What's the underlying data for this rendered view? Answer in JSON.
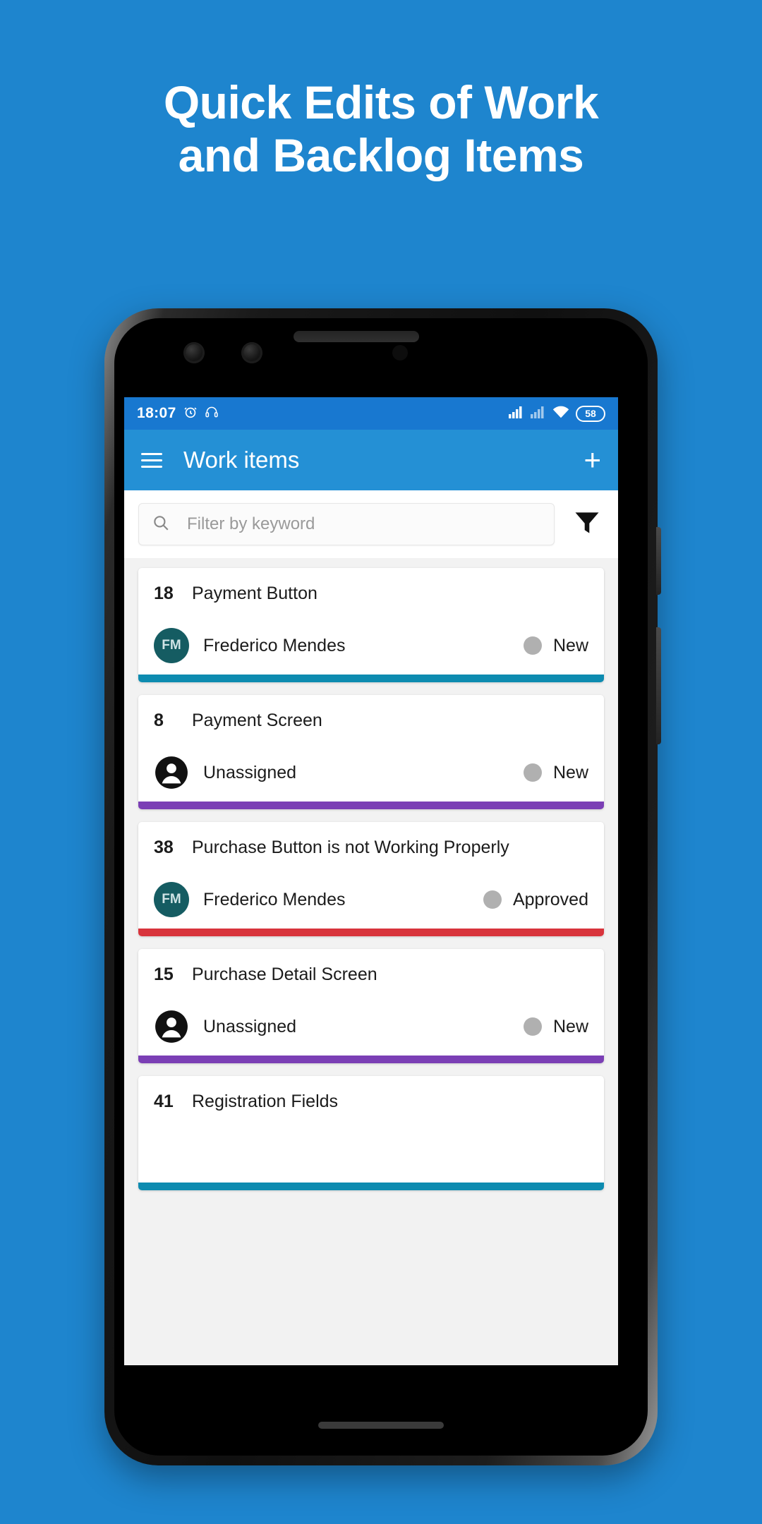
{
  "promo": {
    "background_color": "#1E85CE",
    "headline_line1": "Quick Edits of Work",
    "headline_line2": "and Backlog Items"
  },
  "status_bar": {
    "time": "18:07",
    "alarm_icon": "alarm-icon",
    "headset_icon": "headset-icon",
    "signal_icon_1": "signal-bars-icon",
    "signal_icon_2": "signal-bars-icon",
    "wifi_icon": "wifi-icon",
    "battery_level": "58",
    "background_color": "#1878D0"
  },
  "app_bar": {
    "menu_icon": "list-menu-icon",
    "title": "Work items",
    "add_label": "+",
    "background_color": "#2490D5"
  },
  "filter_bar": {
    "search_icon": "search-icon",
    "search_value": "",
    "search_placeholder": "Filter by keyword",
    "filter_icon": "funnel-filter-icon"
  },
  "work_items": [
    {
      "id": "18",
      "title": "Payment Button",
      "assignee": "Frederico Mendes",
      "assignee_initials": "FM",
      "assigned": true,
      "status": "New",
      "status_dot_color": "#b0b0b0",
      "accent_color": "#0D8BB0"
    },
    {
      "id": "8",
      "title": "Payment Screen",
      "assignee": "Unassigned",
      "assignee_initials": "",
      "assigned": false,
      "status": "New",
      "status_dot_color": "#b0b0b0",
      "accent_color": "#7B3FB5"
    },
    {
      "id": "38",
      "title": "Purchase Button is not Working Properly",
      "assignee": "Frederico Mendes",
      "assignee_initials": "FM",
      "assigned": true,
      "status": "Approved",
      "status_dot_color": "#b0b0b0",
      "accent_color": "#D8343C"
    },
    {
      "id": "15",
      "title": "Purchase Detail Screen",
      "assignee": "Unassigned",
      "assignee_initials": "",
      "assigned": false,
      "status": "New",
      "status_dot_color": "#b0b0b0",
      "accent_color": "#7B3FB5"
    },
    {
      "id": "41",
      "title": "Registration Fields",
      "assignee": "",
      "assignee_initials": "",
      "assigned": false,
      "status": "",
      "status_dot_color": "#b0b0b0",
      "accent_color": "#0D8BB0"
    }
  ]
}
